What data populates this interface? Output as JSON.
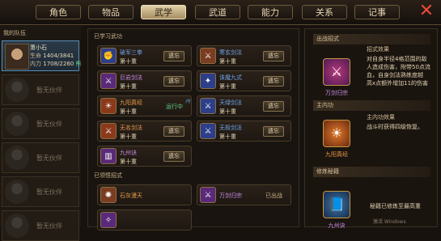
{
  "tabs": [
    "角色",
    "物品",
    "武学",
    "武道",
    "能力",
    "关系",
    "记事"
  ],
  "active_tab": 2,
  "left": {
    "header": "我的队伍",
    "hero": {
      "name": "萧小石",
      "hp_label": "生命",
      "hp": "1404/3841",
      "internal_label": "内力",
      "internal": "1708/2260",
      "tag": "熊"
    },
    "empty_label": "暂无伙伴"
  },
  "middle": {
    "learned_title": "已学习武功",
    "skills": [
      {
        "name": "破军三拳",
        "level": "第十重",
        "action": "遗忘",
        "color": "#6fa2e6",
        "icon": "fist-icon",
        "ico_bg": "#2d3f8a"
      },
      {
        "name": "寒玄剑法",
        "level": "第十重",
        "action": "遗忘",
        "color": "#6fa2e6",
        "icon": "sword-icon",
        "ico_bg": "#7a3d22"
      },
      {
        "name": "巨岩剑法",
        "level": "第十重",
        "action": "遗忘",
        "color": "#c58be6",
        "icon": "sword-icon",
        "ico_bg": "#5a2a7a"
      },
      {
        "name": "诛魔九式",
        "level": "第十重",
        "action": "遗忘",
        "color": "#6fa2e6",
        "icon": "slash-icon",
        "ico_bg": "#2d3f8a"
      },
      {
        "name": "九阳真经",
        "level": "第十重",
        "action": "运行中",
        "color": "#e89a4a",
        "icon": "sun-icon",
        "ico_bg": "#8a3a1a",
        "badge": "内"
      },
      {
        "name": "天绿剑法",
        "level": "第十重",
        "action": "遗忘",
        "color": "#6fa2e6",
        "icon": "sword-icon",
        "ico_bg": "#2d3f8a"
      },
      {
        "name": "无名剑法",
        "level": "第十重",
        "action": "遗忘",
        "color": "#e89a4a",
        "icon": "sword-icon",
        "ico_bg": "#8a3a1a"
      },
      {
        "name": "无极剑法",
        "level": "第十重",
        "action": "遗忘",
        "color": "#6fa2e6",
        "icon": "sword-icon",
        "ico_bg": "#2d3f8a"
      },
      {
        "name": "九州诀",
        "level": "第十重",
        "action": "遗忘",
        "color": "#c58be6",
        "icon": "scroll-icon",
        "ico_bg": "#5a2a7a"
      }
    ],
    "combo_title": "已领悟招式",
    "combos": [
      {
        "name": "石灰漫天",
        "status": "",
        "color": "#e89a4a",
        "icon": "dust-icon",
        "ico_bg": "#7a3d22"
      },
      {
        "name": "万剑归宗",
        "status": "已出战",
        "color": "#c58be6",
        "icon": "swords-icon",
        "ico_bg": "#5a2a7a"
      },
      {
        "name": "",
        "status": "",
        "color": "#c58be6",
        "icon": "partial-icon",
        "ico_bg": "#5a2a7a"
      }
    ]
  },
  "right": {
    "combo_section": "出战招式",
    "combo_name": "万剑归宗",
    "combo_effect_title": "招式效果",
    "combo_effect_lines": [
      "对自身半径4格范围的敌",
      "人造成伤害，附带50点流",
      "血，自身剑法熟练度越",
      "高x点额外增加11的伤害"
    ],
    "internal_section": "主内功",
    "internal_effect_title": "主内功效果",
    "internal_effect_line": "战斗时获得四级恢复。",
    "internal_name": "九阳真经",
    "book_section": "修炼秘籍",
    "book_note": "秘籍已修炼至最高重",
    "book_name": "九州诀",
    "watermark": "激活 Windows"
  }
}
